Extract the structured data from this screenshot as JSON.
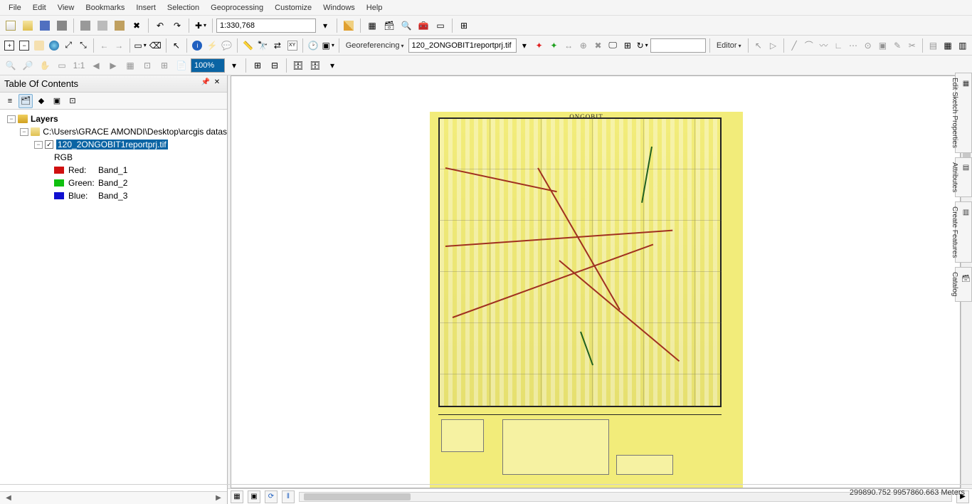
{
  "menubar": [
    "File",
    "Edit",
    "View",
    "Bookmarks",
    "Insert",
    "Selection",
    "Geoprocessing",
    "Customize",
    "Windows",
    "Help"
  ],
  "scale_input": "1:330,768",
  "georef_label": "Georeferencing",
  "georef_layer_select": "120_2ONGOBIT1reportprj.tif",
  "editor_label": "Editor",
  "zoom_percent": "100%",
  "toc": {
    "title": "Table Of Contents",
    "root": "Layers",
    "folder_path": "C:\\Users\\GRACE AMONDI\\Desktop\\arcgis datas",
    "layer_name": "120_2ONGOBIT1reportprj.tif",
    "render_type": "RGB",
    "bands": [
      {
        "color": "#d01010",
        "label": "Red:",
        "name": "Band_1"
      },
      {
        "color": "#10c010",
        "label": "Green:",
        "name": "Band_2"
      },
      {
        "color": "#1010d0",
        "label": "Blue:",
        "name": "Band_3"
      }
    ]
  },
  "map_title": "ONGOBIT",
  "side_tabs": [
    "Edit Sketch Properties",
    "Attributes",
    "Create Features",
    "Catalog"
  ],
  "status_coords": "299890.752 9957860.663 Meters"
}
